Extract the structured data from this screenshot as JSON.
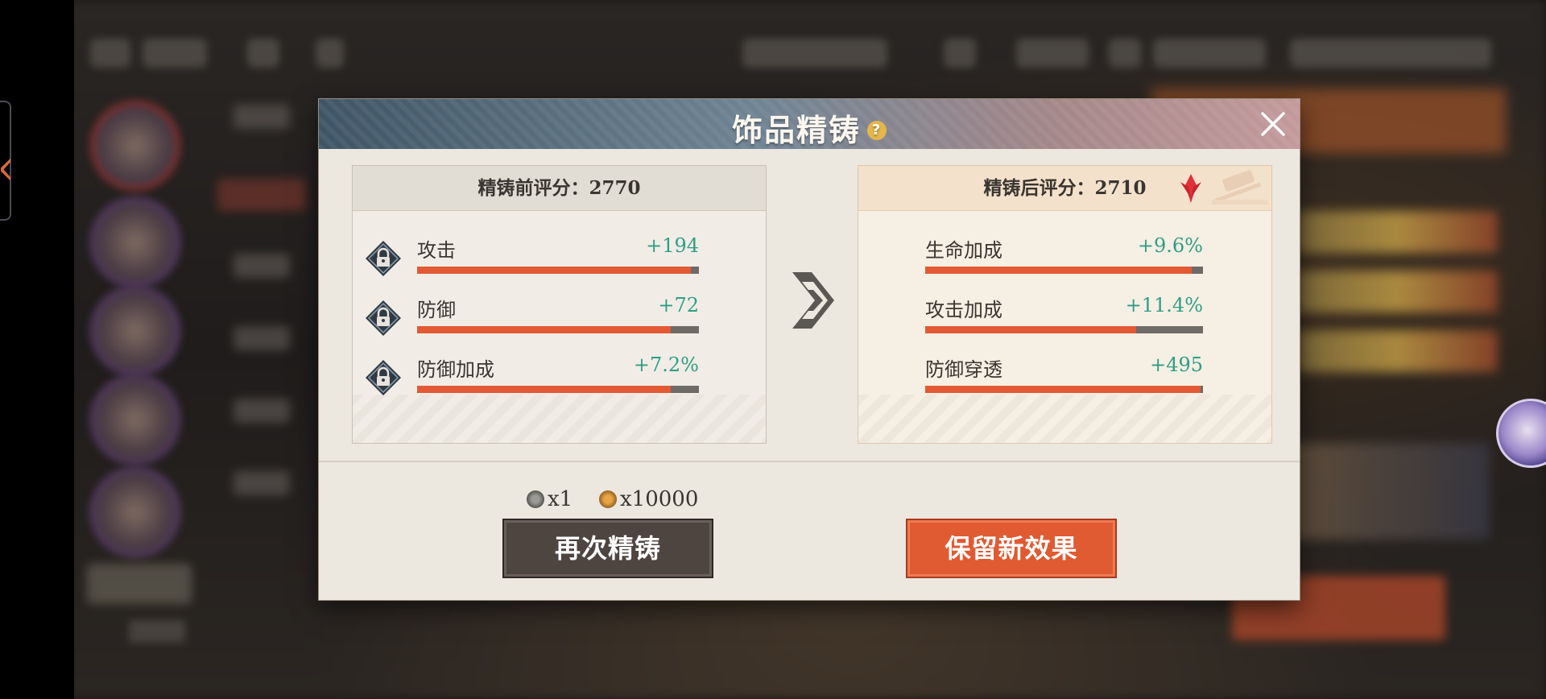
{
  "dialog": {
    "title": "饰品精铸",
    "help_icon": "?",
    "close_icon": "close-icon"
  },
  "before": {
    "header": "精铸前评分：2770",
    "stats": [
      {
        "name": "攻击",
        "value": "+194",
        "fill": 0.97
      },
      {
        "name": "防御",
        "value": "+72",
        "fill": 0.9
      },
      {
        "name": "防御加成",
        "value": "+7.2%",
        "fill": 0.9
      }
    ]
  },
  "after": {
    "header": "精铸后评分：2710",
    "stats": [
      {
        "name": "生命加成",
        "value": "+9.6%",
        "fill": 0.96
      },
      {
        "name": "攻击加成",
        "value": "+11.4%",
        "fill": 0.76
      },
      {
        "name": "防御穿透",
        "value": "+495",
        "fill": 0.99
      }
    ]
  },
  "cost": {
    "item_qty": "x1",
    "coin_qty": "x10000"
  },
  "buttons": {
    "reforge": "再次精铸",
    "keep": "保留新效果"
  },
  "colors": {
    "accent": "#e25a34",
    "positive_value": "#2f9e83",
    "dark_button": "#4e4440"
  }
}
